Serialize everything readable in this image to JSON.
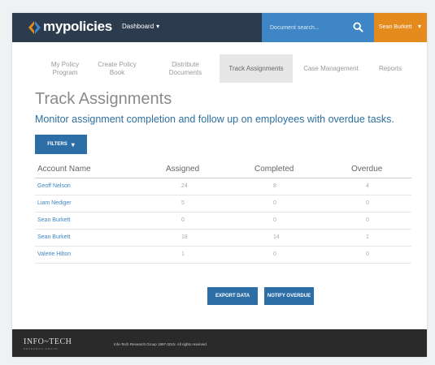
{
  "header": {
    "logo_text": "mypolicies",
    "dashboard_label": "Dashboard",
    "search_placeholder": "Document search...",
    "user_name": "Sean Burkett"
  },
  "tabs": [
    {
      "label": "My Policy Program"
    },
    {
      "label": "Create Policy Book"
    },
    {
      "label": "Distribute Documents"
    },
    {
      "label": "Track Assignments",
      "active": true
    },
    {
      "label": "Case Management"
    },
    {
      "label": "Reports"
    }
  ],
  "page": {
    "title": "Track Assignments",
    "subtitle": "Monitor assignment completion and follow up on employees with overdue tasks.",
    "filters_label": "FILTERS"
  },
  "table": {
    "columns": [
      "Account Name",
      "Assigned",
      "Completed",
      "Overdue"
    ],
    "rows": [
      [
        "Geoff Nelson",
        "24",
        "8",
        "4"
      ],
      [
        "Liam Nediger",
        "5",
        "0",
        "0"
      ],
      [
        "Sean Burkett",
        "0",
        "0",
        "0"
      ],
      [
        "Sean Burkett",
        "18",
        "14",
        "1"
      ],
      [
        "Valerie Hilton",
        "1",
        "0",
        "0"
      ]
    ]
  },
  "actions": {
    "export_label": "EXPORT DATA",
    "notify_label": "NOTIFY OVERDUE"
  },
  "footer": {
    "logo": "INFO~TECH",
    "logo_sub": "RESEARCH GROUP",
    "copyright": "Info-Tech Research Group 1997-2015. All rights reserved."
  },
  "colors": {
    "header_bg": "#2d3b4f",
    "search_bg": "#3f86c6",
    "user_bg": "#e58a1c",
    "button_bg": "#2d6ea7",
    "link": "#3f86c6",
    "footer_bg": "#2a2a2a"
  },
  "icons": {
    "logo": "chevron-brackets-logo-icon",
    "search": "search-icon",
    "dropdown": "chevron-down-icon"
  }
}
